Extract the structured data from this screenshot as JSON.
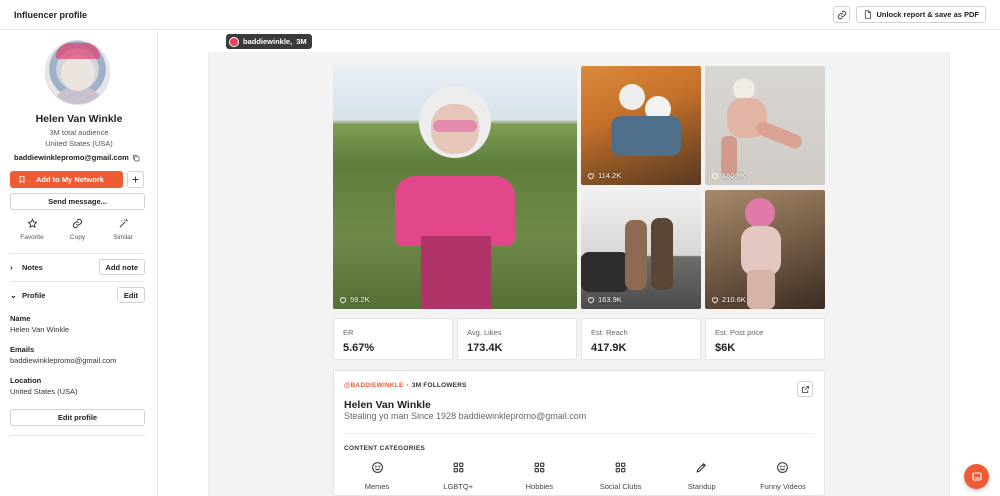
{
  "header": {
    "title": "Influencer profile",
    "link_icon": "link-icon",
    "unlock_label": "Unlock report & save as PDF",
    "unlock_icon": "document-icon"
  },
  "sidebar": {
    "name": "Helen Van Winkle",
    "audience": "3M total audience",
    "location": "United States (USA)",
    "email": "baddiewinklepromo@gmail.com",
    "add_network_label": "Add to My Network",
    "send_message_label": "Send message...",
    "actions": [
      {
        "label": "Favorite",
        "icon": "star-icon"
      },
      {
        "label": "Copy",
        "icon": "link-icon"
      },
      {
        "label": "Similar",
        "icon": "magic-wand-icon"
      }
    ],
    "notes_label": "Notes",
    "add_note_label": "Add note",
    "profile_label": "Profile",
    "edit_label": "Edit",
    "fields": {
      "name_label": "Name",
      "name_value": "Helen Van Winkle",
      "emails_label": "Emails",
      "emails_value": "baddiewinklepromo@gmail.com",
      "location_label": "Location",
      "location_value": "United States (USA)"
    },
    "edit_profile_label": "Edit profile"
  },
  "account_chip": {
    "handle": "baddiewinkle,",
    "followers": "3M",
    "icon": "instagram-icon"
  },
  "photos": [
    {
      "likes": "59.2K"
    },
    {
      "likes": "114.2K"
    },
    {
      "likes": "180.8K"
    },
    {
      "likes": "163.9K"
    },
    {
      "likes": "210.6K"
    }
  ],
  "stats": [
    {
      "label": "ER",
      "value": "5.67%"
    },
    {
      "label": "Avg. Likes",
      "value": "173.4K"
    },
    {
      "label": "Est. Reach",
      "value": "417.9K"
    },
    {
      "label": "Est. Post price",
      "value": "$6K"
    }
  ],
  "profile_card": {
    "handle": "@BADDIEWINKLE",
    "separator": "·",
    "followers": "3M FOLLOWERS",
    "name": "Helen Van Winkle",
    "bio": "Stealing yo man Since 1928 baddiewinklepromo@gmail.com",
    "categories_title": "CONTENT CATEGORIES",
    "categories": [
      {
        "label": "Memes",
        "icon": "smile-icon"
      },
      {
        "label": "LGBTQ+",
        "icon": "grid-icon"
      },
      {
        "label": "Hobbies",
        "icon": "grid-icon"
      },
      {
        "label": "Social Clubs",
        "icon": "grid-icon"
      },
      {
        "label": "Standup",
        "icon": "pen-icon"
      },
      {
        "label": "Funny Videos",
        "icon": "smile-icon"
      }
    ]
  },
  "chat_icon": "chat-icon"
}
